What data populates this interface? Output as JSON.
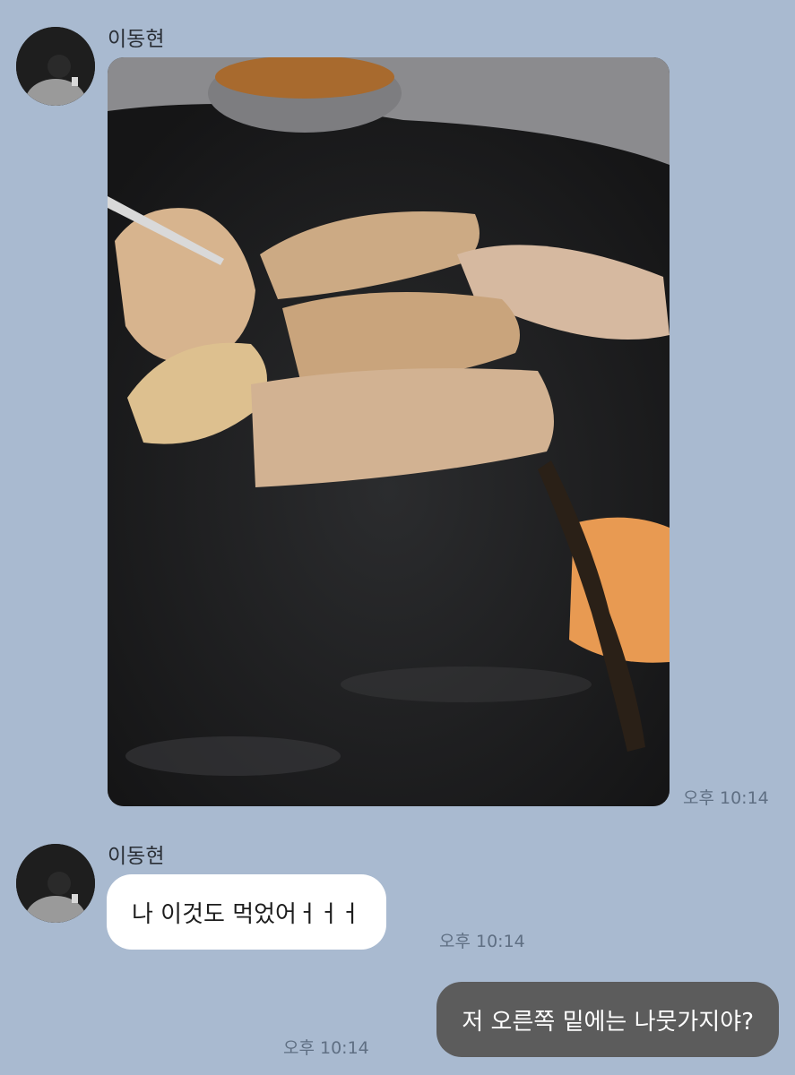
{
  "chat": {
    "messages": [
      {
        "sender": "이동현",
        "type": "image",
        "image_description": "grilled pork belly on a black grill plate",
        "time": "오후 10:14"
      },
      {
        "sender": "이동현",
        "type": "text",
        "text": "나 이것도 먹었어ㅓㅓㅓ",
        "time": "오후 10:14"
      },
      {
        "sender": "me",
        "type": "text",
        "text": "저 오른쪽 밑에는 나뭇가지야?",
        "time": "오후 10:14"
      }
    ]
  },
  "colors": {
    "background": "#a9bad0",
    "incoming_bubble": "#ffffff",
    "outgoing_bubble": "#5c5c5c",
    "timestamp": "#5f6f83"
  }
}
